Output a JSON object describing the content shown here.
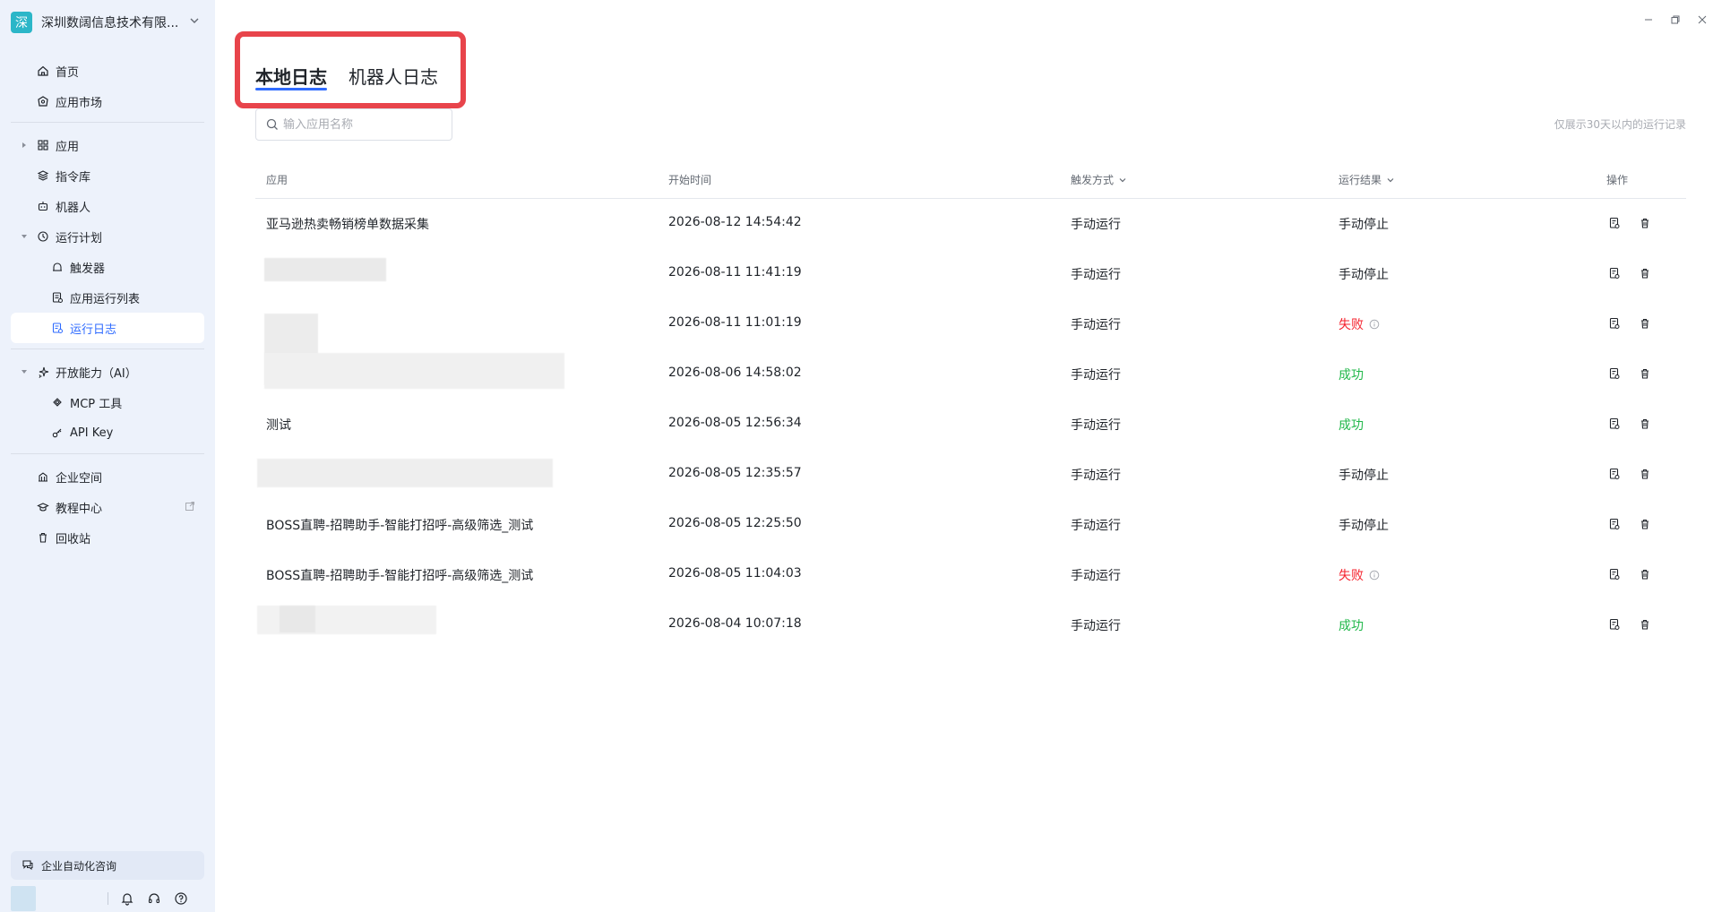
{
  "sidebar": {
    "org_logo": "深",
    "org_name": "深圳数阔信息技术有限...",
    "items": [
      {
        "label": "首页",
        "icon": "home-icon"
      },
      {
        "label": "应用市场",
        "icon": "market-icon"
      },
      {
        "label": "应用",
        "icon": "grid-icon"
      },
      {
        "label": "指令库",
        "icon": "layers-icon"
      },
      {
        "label": "机器人",
        "icon": "robot-icon"
      },
      {
        "label": "运行计划",
        "icon": "clock-icon"
      },
      {
        "label": "触发器",
        "icon": "trigger-icon"
      },
      {
        "label": "应用运行列表",
        "icon": "list-icon"
      },
      {
        "label": "运行日志",
        "icon": "log-icon"
      },
      {
        "label": "开放能力（AI）",
        "icon": "sparkle-icon"
      },
      {
        "label": "MCP 工具",
        "icon": "mcp-icon"
      },
      {
        "label": "API Key",
        "icon": "key-icon"
      },
      {
        "label": "企业空间",
        "icon": "building-icon"
      },
      {
        "label": "教程中心",
        "icon": "graduation-icon"
      },
      {
        "label": "回收站",
        "icon": "trash-icon"
      }
    ],
    "consult_label": "企业自动化咨询"
  },
  "tabs": [
    {
      "label": "本地日志",
      "active": true
    },
    {
      "label": "机器人日志",
      "active": false
    }
  ],
  "search": {
    "placeholder": "输入应用名称",
    "value": ""
  },
  "note": "仅展示30天以内的运行记录",
  "table": {
    "headers": {
      "app": "应用",
      "start_time": "开始时间",
      "trigger": "触发方式",
      "result": "运行结果",
      "action": "操作"
    },
    "rows": [
      {
        "app": "亚马逊热卖畅销榜单数据采集",
        "time": "2026-08-12 14:54:42",
        "trigger": "手动运行",
        "result": "手动停止",
        "status": "stop"
      },
      {
        "app": "",
        "time": "2026-08-11 11:41:19",
        "trigger": "手动运行",
        "result": "手动停止",
        "status": "stop"
      },
      {
        "app": "",
        "time": "2026-08-11 11:01:19",
        "trigger": "手动运行",
        "result": "失败",
        "status": "fail"
      },
      {
        "app": "",
        "time": "2026-08-06 14:58:02",
        "trigger": "手动运行",
        "result": "成功",
        "status": "ok"
      },
      {
        "app": "测试",
        "time": "2026-08-05 12:56:34",
        "trigger": "手动运行",
        "result": "成功",
        "status": "ok"
      },
      {
        "app": "",
        "time": "2026-08-05 12:35:57",
        "trigger": "手动运行",
        "result": "手动停止",
        "status": "stop"
      },
      {
        "app": "BOSS直聘-招聘助手-智能打招呼-高级筛选_测试",
        "time": "2026-08-05 12:25:50",
        "trigger": "手动运行",
        "result": "手动停止",
        "status": "stop"
      },
      {
        "app": "BOSS直聘-招聘助手-智能打招呼-高级筛选_测试",
        "time": "2026-08-05 11:04:03",
        "trigger": "手动运行",
        "result": "失败",
        "status": "fail"
      },
      {
        "app": "",
        "time": "2026-08-04 10:07:18",
        "trigger": "手动运行",
        "result": "成功",
        "status": "ok"
      }
    ]
  },
  "colors": {
    "accent": "#2f6bff",
    "highlight": "#e8444b",
    "fail": "#f5222d",
    "success": "#21b84a",
    "sidebar_bg": "#edf2fb"
  }
}
